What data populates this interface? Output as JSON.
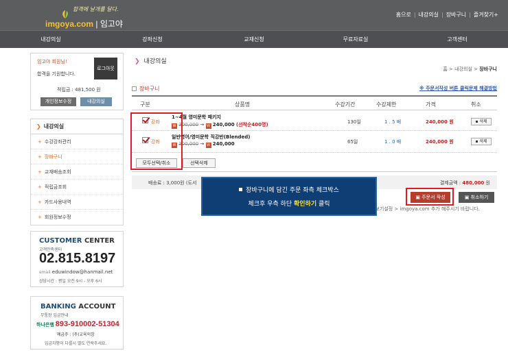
{
  "header": {
    "logo_tagline": "합격에 날개를 달다.",
    "logo_main": "imgoya.com",
    "logo_sub": "| 임고야",
    "links": [
      "홈으로",
      "내강의실",
      "장바구니",
      "즐겨찾기+"
    ]
  },
  "gnb": [
    "내강의실",
    "강좌신청",
    "교재신청",
    "무료자료실",
    "고객센터"
  ],
  "login_box": {
    "greeting": "임고야 회원님!",
    "message": "합격을 기원합니다.",
    "logout": "로그아웃",
    "points": "적립금 : 481,500 원",
    "btn_profile": "개인정보수정",
    "btn_myroom": "내강의실"
  },
  "menu": {
    "title": "내강의실",
    "items": [
      "수강강좌관리",
      "장바구니",
      "교재배송조회",
      "적립금조회",
      "카드사용내역",
      "회원정보수정"
    ],
    "active_index": 1
  },
  "customer": {
    "title_a": "CUSTOMER",
    "title_b": "CENTER",
    "sub": "고객만족센터",
    "phone": "02.815.8197",
    "email_label": "email",
    "email": "eduwindow@hanmail.net",
    "hours": "상담시간 : 평일 오전 9시 - 오후 6시"
  },
  "banking": {
    "title_a": "BANKING",
    "title_b": "ACCOUNT",
    "sub": "무통장 입금안내",
    "bank": "하나은행",
    "account": "893-910002-51304",
    "holder": "예금주 : (주)교육의창",
    "note": "입금자명이 다를시 별도 연락주세요."
  },
  "main": {
    "title": "내강의실",
    "breadcrumb_prefix": "홈 > 내강의실 >",
    "breadcrumb_current": "장바구니",
    "section_title": "장바구니",
    "section_link": "※ 주문서작성 버튼 클릭문제 해결방법",
    "columns": [
      "구분",
      "상품명",
      "수강기간",
      "수강제한",
      "가격",
      "취소"
    ],
    "rows": [
      {
        "kind": "강좌",
        "name": "1~4월 영미문학 패키지",
        "old_price": "300,000",
        "new_price": "240,000",
        "note": "(선착순400명)",
        "period": "130일",
        "limit": "1 . 5 배",
        "price": "240,000 원",
        "cancel": "삭제"
      },
      {
        "kind": "강좌",
        "name": "일반영어/영미문학 직강반(Blended)",
        "old_price": "300,000",
        "new_price": "240,000",
        "note": "",
        "period": "65일",
        "limit": "1 . 0 배",
        "price": "240,000 원",
        "cancel": "삭제"
      }
    ],
    "btn_select_all": "모두선택/취소",
    "btn_delete_selected": "선택삭제",
    "shipping": "배송료 : 3,000원 (도서",
    "total_label": "결제금액 :",
    "total_value": "480,000",
    "total_unit": "원",
    "btn_order": "주문서 작성",
    "btn_cancel": "취소하기",
    "notice": "정보기설정 > imgoya.com 추가 해주시기 바랍니다."
  },
  "tooltip": {
    "line1": "장바구니에 담긴 주문 좌측 체크박스",
    "line2_prefix": "체크후 우측 하단",
    "line2_highlight": "확인하기",
    "line2_suffix": "클릭"
  },
  "colors": {
    "header_bg": "#5b5d5f",
    "accent_orange": "#e06a20",
    "price_red": "#d11a1a",
    "tooltip_bg": "#0f3e74",
    "highlight_yellow": "#f7e03a"
  }
}
